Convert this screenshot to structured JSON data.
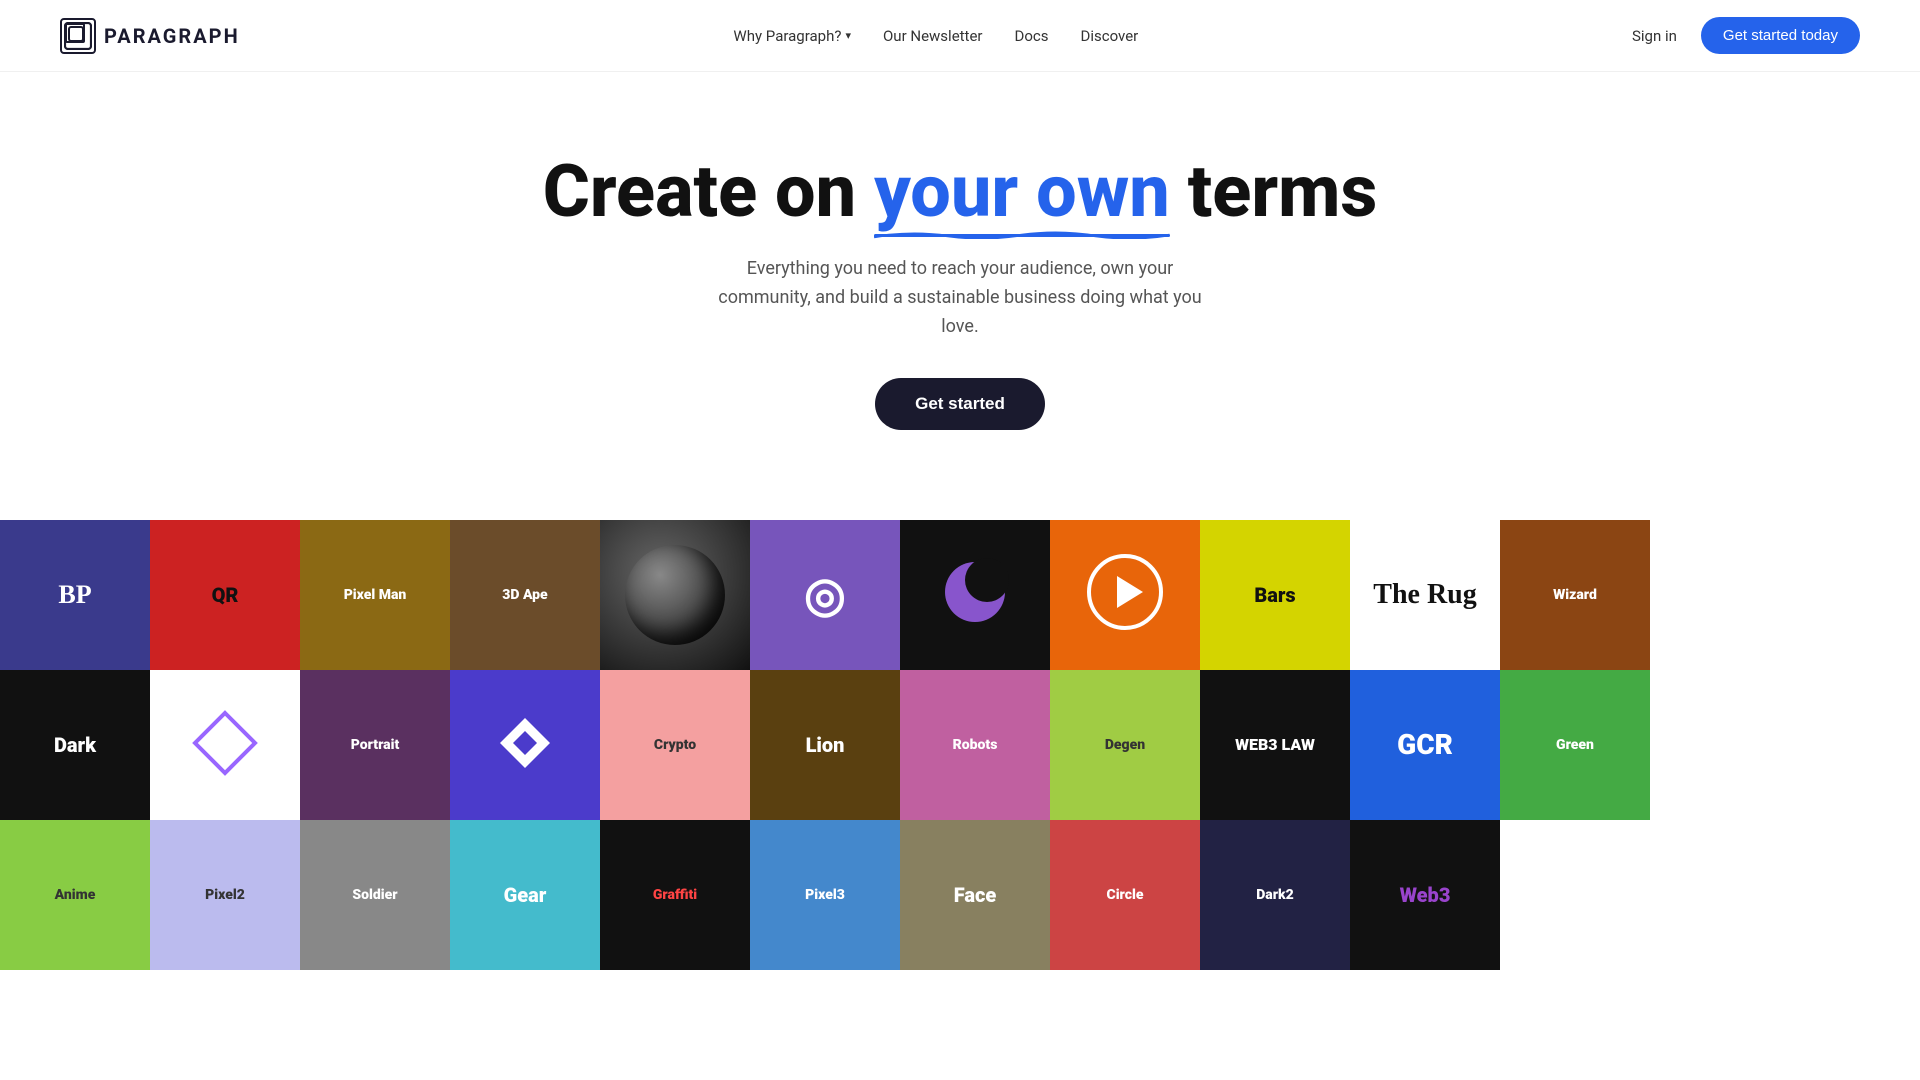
{
  "nav": {
    "logo_text": "PARAGRAPH",
    "links": [
      {
        "label": "Why Paragraph?",
        "has_dropdown": true
      },
      {
        "label": "Our Newsletter"
      },
      {
        "label": "Docs"
      },
      {
        "label": "Discover"
      }
    ],
    "signin_label": "Sign in",
    "cta_label": "Get started today"
  },
  "hero": {
    "headline_start": "Create on ",
    "headline_highlight": "your own",
    "headline_end": " terms",
    "subtext": "Everything you need to reach your audience, own your community, and build a sustainable business doing what you love.",
    "cta_label": "Get started"
  },
  "icons": {
    "row1": [
      {
        "bg": "#3a3a8c",
        "label": "BP",
        "color": "#fff"
      },
      {
        "bg": "#b22222",
        "label": "QR",
        "color": "#111"
      },
      {
        "bg": "#8B6914",
        "label": "Pixel Man",
        "color": "#fff"
      },
      {
        "bg": "#6B4C2A",
        "label": "3D Ape",
        "color": "#fff"
      },
      {
        "bg": "#222",
        "label": "Ball",
        "color": "#fff"
      },
      {
        "bg": "#7B5EA7",
        "label": "Lens",
        "color": "#fff"
      },
      {
        "bg": "#111",
        "label": "Moon",
        "color": "#fff"
      },
      {
        "bg": "#E8650A",
        "label": "Play",
        "color": "#fff"
      },
      {
        "bg": "#d4d400",
        "label": "Bars",
        "color": "#111"
      },
      {
        "bg": "#111",
        "label": "Rug",
        "color": "#fff"
      },
      {
        "bg": "#8B4513",
        "label": "Wizard",
        "color": "#fff"
      }
    ],
    "row2": [
      {
        "bg": "#111",
        "label": "Dark",
        "color": "#fff"
      },
      {
        "bg": "#f0f0ff",
        "label": "Diamond",
        "color": "#9966ff"
      },
      {
        "bg": "#5a3060",
        "label": "Portrait",
        "color": "#fff"
      },
      {
        "bg": "#4B3BCB",
        "label": "Rarible",
        "color": "#fff"
      },
      {
        "bg": "#f4a0a0",
        "label": "Crypto",
        "color": "#333"
      },
      {
        "bg": "#5a4010",
        "label": "Lion",
        "color": "#fff"
      },
      {
        "bg": "#c060a0",
        "label": "Robots",
        "color": "#fff"
      },
      {
        "bg": "#a0cc44",
        "label": "Degen",
        "color": "#333"
      },
      {
        "bg": "#111",
        "label": "Web3Law",
        "color": "#fff"
      },
      {
        "bg": "#2060cc",
        "label": "GCR",
        "color": "#fff"
      },
      {
        "bg": "#44aa44",
        "label": "Green",
        "color": "#fff"
      }
    ],
    "row3": [
      {
        "bg": "#88cc44",
        "label": "Anime",
        "color": "#333"
      },
      {
        "bg": "#bbbbee",
        "label": "Pixel2",
        "color": "#333"
      },
      {
        "bg": "#888888",
        "label": "Soldier",
        "color": "#fff"
      },
      {
        "bg": "#44bbcc",
        "label": "Gear",
        "color": "#fff"
      },
      {
        "bg": "#111",
        "label": "Graffiti",
        "color": "#ff4444"
      },
      {
        "bg": "#4488cc",
        "label": "Pixel3",
        "color": "#fff"
      },
      {
        "bg": "#888060",
        "label": "Face",
        "color": "#fff"
      },
      {
        "bg": "#cc4444",
        "label": "Circle",
        "color": "#fff"
      },
      {
        "bg": "#222244",
        "label": "Dark2",
        "color": "#fff"
      },
      {
        "bg": "#111",
        "label": "Web3",
        "color": "#9944cc"
      }
    ]
  }
}
